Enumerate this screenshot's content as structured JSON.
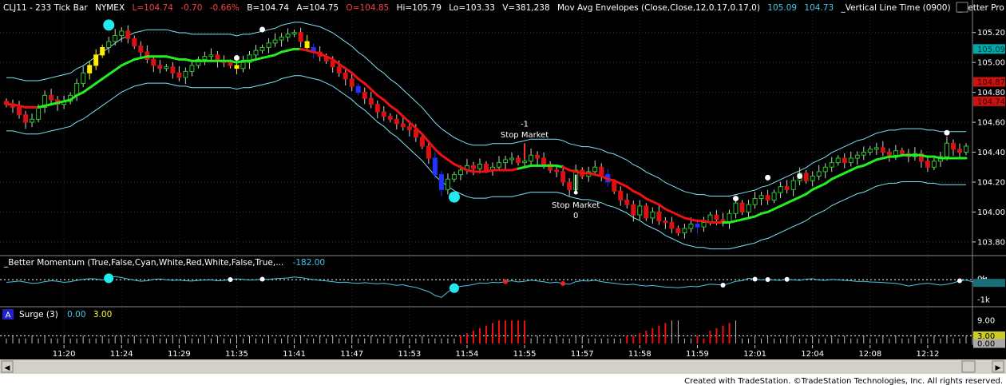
{
  "header": {
    "symbol": "CLJ11 - 233 Tick Bar",
    "exchange": "NYMEX",
    "last": "L=104.74",
    "change": "-0.70",
    "change_pct": "-0.66%",
    "bid": "B=104.74",
    "ask": "A=104.75",
    "open": "O=104.85",
    "high": "Hi=105.79",
    "low": "Lo=103.33",
    "volume": "V=381,238",
    "study1": "Mov Avg Envelopes (Close,Close,12,0.17,0.17,0)",
    "study1_v1": "105.09",
    "study1_v2": "104.73",
    "study2": "_Vertical Line Time (0900)",
    "study3": "_Better Pro Am PB (Blue,Yello"
  },
  "panel2": {
    "label": "_Better Momentum (True,False,Cyan,White,Red,White,False,True,...",
    "value": "-182.00"
  },
  "panel3": {
    "icon_label": "A",
    "label": "Surge (3)",
    "v1": "0.00",
    "v2": "3.00"
  },
  "footer": {
    "credit": "Created with TradeStation. ©TradeStation Technologies, Inc. All rights reserved."
  },
  "annotations": [
    {
      "text": "-1",
      "xi": 81,
      "price": 104.57,
      "dx": 0
    },
    {
      "text": "Stop Market",
      "xi": 81,
      "price": 104.5,
      "dx": 0
    },
    {
      "text": "Stop Market",
      "xi": 89,
      "price": 104.03,
      "dx": 0
    },
    {
      "text": "0",
      "xi": 89,
      "price": 103.96,
      "dx": 0
    }
  ],
  "colors": {
    "bg": "#000000",
    "envelope": "#7fe3f5",
    "ma_up": "#22ee22",
    "ma_down": "#ee1111",
    "bull": "#22cc22",
    "bear": "#dd1111",
    "momentum": "#46c8e8",
    "surge_red": "#ee1111",
    "surge_white": "#ffffff",
    "scale_red": "#cc1111"
  },
  "chart_data": [
    {
      "type": "candlestick",
      "title": "CLJ11 - 233 Tick Bar",
      "x_ticks": [
        "11:20",
        "11:24",
        "11:29",
        "11:35",
        "11:41",
        "11:47",
        "11:53",
        "11:54",
        "11:55",
        "11:57",
        "11:58",
        "11:59",
        "12:01",
        "12:04",
        "12:08",
        "12:12"
      ],
      "x_tick_index": [
        9,
        18,
        27,
        36,
        45,
        54,
        63,
        72,
        81,
        90,
        99,
        108,
        117,
        126,
        135,
        144
      ],
      "y_ticks": [
        "105.20",
        "105.00",
        "104.80",
        "104.60",
        "104.40",
        "104.20",
        "104.00",
        "103.80"
      ],
      "ylim": [
        103.73,
        105.3
      ],
      "price_markers": [
        {
          "label": "105.09",
          "value": 105.09,
          "color": "#00aaaa"
        },
        {
          "label": "104.87",
          "value": 104.87,
          "color": "#cc1111"
        },
        {
          "label": "104.74",
          "value": 104.74,
          "color": "#cc1111"
        }
      ],
      "close": [
        104.72,
        104.7,
        104.65,
        104.6,
        104.62,
        104.7,
        104.78,
        104.75,
        104.72,
        104.74,
        104.78,
        104.86,
        104.93,
        104.98,
        105.05,
        105.1,
        105.14,
        105.18,
        105.21,
        105.16,
        105.11,
        105.07,
        105.02,
        104.98,
        104.96,
        104.97,
        104.93,
        104.9,
        104.94,
        104.98,
        105.02,
        105.04,
        105.05,
        105.01,
        105.0,
        104.98,
        104.96,
        105.0,
        105.05,
        105.08,
        105.1,
        105.13,
        105.15,
        105.17,
        105.19,
        105.2,
        105.14,
        105.1,
        105.07,
        105.04,
        105.01,
        104.97,
        104.93,
        104.89,
        104.84,
        104.8,
        104.76,
        104.72,
        104.67,
        104.64,
        104.62,
        104.59,
        104.57,
        104.55,
        104.5,
        104.44,
        104.36,
        104.25,
        104.15,
        104.22,
        104.25,
        104.28,
        104.31,
        104.29,
        104.32,
        104.28,
        104.3,
        104.33,
        104.35,
        104.36,
        104.33,
        104.34,
        104.38,
        104.36,
        104.32,
        104.28,
        104.27,
        104.2,
        104.15,
        104.28,
        104.24,
        104.27,
        104.3,
        104.25,
        104.2,
        104.14,
        104.08,
        104.05,
        103.98,
        104.04,
        103.96,
        104.0,
        103.94,
        103.93,
        103.89,
        103.86,
        103.89,
        103.92,
        103.9,
        103.93,
        103.98,
        103.95,
        103.93,
        103.99,
        104.06,
        104.0,
        104.05,
        104.09,
        104.11,
        104.08,
        104.13,
        104.17,
        104.15,
        104.21,
        104.26,
        104.21,
        104.24,
        104.27,
        104.3,
        104.33,
        104.36,
        104.33,
        104.36,
        104.38,
        104.4,
        104.42,
        104.43,
        104.4,
        104.38,
        104.41,
        104.39,
        104.37,
        104.39,
        104.34,
        104.3,
        104.34,
        104.37,
        104.46,
        104.42,
        104.4,
        104.44
      ],
      "ma": [
        104.72,
        104.72,
        104.71,
        104.7,
        104.7,
        104.7,
        104.71,
        104.72,
        104.73,
        104.74,
        104.75,
        104.78,
        104.8,
        104.83,
        104.86,
        104.89,
        104.92,
        104.95,
        104.98,
        105.0,
        105.02,
        105.03,
        105.04,
        105.04,
        105.04,
        105.04,
        105.03,
        105.02,
        105.02,
        105.01,
        105.01,
        105.01,
        105.01,
        105.01,
        105.01,
        105.01,
        105.0,
        105.01,
        105.01,
        105.02,
        105.03,
        105.04,
        105.05,
        105.07,
        105.08,
        105.09,
        105.09,
        105.08,
        105.07,
        105.06,
        105.04,
        105.02,
        104.99,
        104.96,
        104.93,
        104.89,
        104.86,
        104.82,
        104.78,
        104.75,
        104.71,
        104.68,
        104.64,
        104.6,
        104.56,
        104.52,
        104.47,
        104.42,
        104.38,
        104.35,
        104.32,
        104.3,
        104.28,
        104.27,
        104.27,
        104.27,
        104.28,
        104.28,
        104.28,
        104.28,
        104.29,
        104.3,
        104.31,
        104.31,
        104.31,
        104.31,
        104.31,
        104.3,
        104.28,
        104.27,
        104.26,
        104.26,
        104.25,
        104.24,
        104.22,
        104.21,
        104.19,
        104.17,
        104.14,
        104.12,
        104.09,
        104.07,
        104.05,
        104.02,
        104.0,
        103.98,
        103.96,
        103.95,
        103.94,
        103.94,
        103.93,
        103.93,
        103.93,
        103.93,
        103.94,
        103.95,
        103.96,
        103.97,
        103.99,
        104.0,
        104.02,
        104.04,
        104.06,
        104.08,
        104.1,
        104.12,
        104.15,
        104.17,
        104.19,
        104.22,
        104.24,
        104.26,
        104.28,
        104.3,
        104.31,
        104.33,
        104.35,
        104.36,
        104.37,
        104.37,
        104.38,
        104.38,
        104.38,
        104.38,
        104.37,
        104.37,
        104.36,
        104.36,
        104.36,
        104.36,
        104.36
      ],
      "ma_color": [
        "r",
        "r",
        "r",
        "r",
        "r",
        "r",
        "g",
        "g",
        "g",
        "g",
        "g",
        "g",
        "g",
        "g",
        "g",
        "g",
        "g",
        "g",
        "g",
        "g",
        "g",
        "g",
        "g",
        "g",
        "g",
        "g",
        "g",
        "g",
        "g",
        "g",
        "g",
        "g",
        "g",
        "g",
        "g",
        "g",
        "g",
        "g",
        "g",
        "g",
        "g",
        "g",
        "g",
        "g",
        "g",
        "g",
        "g",
        "r",
        "r",
        "r",
        "r",
        "r",
        "r",
        "r",
        "r",
        "r",
        "r",
        "r",
        "r",
        "r",
        "r",
        "r",
        "r",
        "r",
        "r",
        "r",
        "r",
        "r",
        "r",
        "r",
        "r",
        "r",
        "r",
        "r",
        "r",
        "r",
        "r",
        "r",
        "r",
        "r",
        "r",
        "g",
        "g",
        "g",
        "g",
        "g",
        "g",
        "g",
        "r",
        "r",
        "r",
        "r",
        "r",
        "r",
        "r",
        "r",
        "r",
        "r",
        "r",
        "r",
        "r",
        "r",
        "r",
        "r",
        "r",
        "r",
        "r",
        "r",
        "r",
        "r",
        "r",
        "r",
        "r",
        "g",
        "g",
        "g",
        "g",
        "g",
        "g",
        "g",
        "g",
        "g",
        "g",
        "g",
        "g",
        "g",
        "g",
        "g",
        "g",
        "g",
        "g",
        "g",
        "g",
        "g",
        "g",
        "g",
        "g",
        "g",
        "g",
        "g",
        "g",
        "g",
        "g",
        "g",
        "g",
        "g",
        "g",
        "g",
        "g",
        "g",
        "g",
        "g",
        "g"
      ],
      "envelope_pct": 0.17,
      "special_bars": [
        {
          "i": 13,
          "color": "yellow"
        },
        {
          "i": 14,
          "color": "yellow"
        },
        {
          "i": 15,
          "color": "yellow"
        },
        {
          "i": 36,
          "color": "yellow"
        },
        {
          "i": 47,
          "color": "yellow"
        },
        {
          "i": 48,
          "color": "blue"
        },
        {
          "i": 55,
          "color": "blue"
        },
        {
          "i": 67,
          "color": "blue"
        },
        {
          "i": 68,
          "color": "blue"
        },
        {
          "i": 94,
          "color": "blue"
        },
        {
          "i": 108,
          "color": "blue"
        }
      ],
      "dots": [
        {
          "i": 16,
          "price": 105.25,
          "color": "cyan"
        },
        {
          "i": 36,
          "price": 105.03,
          "color": "white"
        },
        {
          "i": 40,
          "price": 105.22,
          "color": "white"
        },
        {
          "i": 70,
          "price": 104.1,
          "color": "cyan"
        },
        {
          "i": 114,
          "price": 104.09,
          "color": "white"
        },
        {
          "i": 119,
          "price": 104.23,
          "color": "white"
        },
        {
          "i": 124,
          "price": 104.24,
          "color": "white"
        },
        {
          "i": 147,
          "price": 104.53,
          "color": "white"
        }
      ]
    },
    {
      "type": "line",
      "title": "_Better Momentum",
      "y_ticks": [
        "0k",
        "-0k",
        "-1k"
      ],
      "ylim": [
        -1450,
        600
      ],
      "zero_level": 0,
      "value": -182,
      "values": [
        -150,
        -120,
        -80,
        -140,
        -210,
        -190,
        -110,
        -60,
        -90,
        -150,
        -110,
        -40,
        20,
        60,
        40,
        -20,
        80,
        180,
        120,
        40,
        -30,
        -90,
        -60,
        20,
        40,
        0,
        -40,
        -20,
        -60,
        -80,
        -40,
        -20,
        -10,
        -60,
        -40,
        10,
        50,
        20,
        -20,
        0,
        30,
        20,
        60,
        80,
        100,
        160,
        120,
        60,
        10,
        -40,
        -70,
        -110,
        -160,
        -140,
        -190,
        -210,
        -170,
        -210,
        -230,
        -200,
        -260,
        -320,
        -290,
        -380,
        -440,
        -560,
        -680,
        -900,
        -1010,
        -700,
        -480,
        -380,
        -340,
        -270,
        -190,
        -210,
        -150,
        -170,
        -110,
        -60,
        -130,
        -90,
        -30,
        -70,
        -120,
        -180,
        -140,
        -220,
        -260,
        -110,
        -60,
        -80,
        -30,
        -110,
        -160,
        -200,
        -250,
        -290,
        -260,
        -320,
        -360,
        -330,
        -380,
        -420,
        -440,
        -460,
        -420,
        -380,
        -400,
        -330,
        -250,
        -280,
        -310,
        -210,
        -90,
        -60,
        80,
        30,
        -10,
        10,
        -20,
        -40,
        20,
        -10,
        -40,
        30,
        60,
        -20,
        -40,
        20,
        -10,
        -40,
        -60,
        -100,
        -90,
        -130,
        -140,
        -160,
        -190,
        -210,
        -280,
        -360,
        -300,
        -240,
        -200,
        -250,
        -310,
        -260,
        -180,
        -60,
        -20,
        -120,
        -150
      ],
      "dots": [
        {
          "i": 16,
          "color": "cyan"
        },
        {
          "i": 35,
          "color": "white"
        },
        {
          "i": 40,
          "color": "white"
        },
        {
          "i": 70,
          "color": "cyan"
        },
        {
          "i": 78,
          "color": "red"
        },
        {
          "i": 87,
          "color": "red"
        },
        {
          "i": 112,
          "color": "white"
        },
        {
          "i": 117,
          "color": "white"
        },
        {
          "i": 119,
          "color": "white"
        },
        {
          "i": 122,
          "color": "white"
        },
        {
          "i": 149,
          "color": "white"
        }
      ]
    },
    {
      "type": "bar",
      "title": "Surge (3)",
      "y_ticks": [
        "9.00",
        "3.00",
        "0.00"
      ],
      "ylim": [
        0,
        10
      ],
      "values": [
        2,
        3,
        2,
        2,
        3,
        2,
        3,
        2,
        2,
        3,
        2,
        2,
        3,
        2,
        2,
        3,
        2,
        3,
        3,
        2,
        3,
        2,
        2,
        3,
        2,
        2,
        3,
        2,
        3,
        2,
        2,
        3,
        2,
        3,
        2,
        2,
        3,
        2,
        3,
        2,
        2,
        3,
        2,
        2,
        3,
        2,
        3,
        2,
        2,
        3,
        2,
        3,
        2,
        2,
        3,
        2,
        2,
        3,
        2,
        2,
        3,
        2,
        3,
        2,
        2,
        3,
        2,
        2,
        2,
        2,
        2,
        3,
        4,
        5,
        6,
        7,
        8,
        9,
        9,
        9,
        9,
        9,
        2,
        3,
        2,
        2,
        3,
        2,
        2,
        3,
        3,
        2,
        2,
        2,
        2,
        2,
        2,
        3,
        3,
        4,
        5,
        6,
        7,
        8,
        9,
        9,
        2,
        2,
        3,
        2,
        5,
        6,
        7,
        8,
        9,
        2,
        2,
        3,
        2,
        3,
        2,
        2,
        3,
        3,
        2,
        2,
        3,
        2,
        2,
        3,
        2,
        3,
        2,
        2,
        3,
        2,
        2,
        3,
        2,
        3,
        2,
        2,
        3,
        2,
        2,
        3,
        2,
        3,
        2,
        2,
        3,
        2
      ],
      "red_ranges": [
        [
          71,
          81
        ],
        [
          97,
          103
        ],
        [
          108,
          113
        ]
      ]
    }
  ]
}
